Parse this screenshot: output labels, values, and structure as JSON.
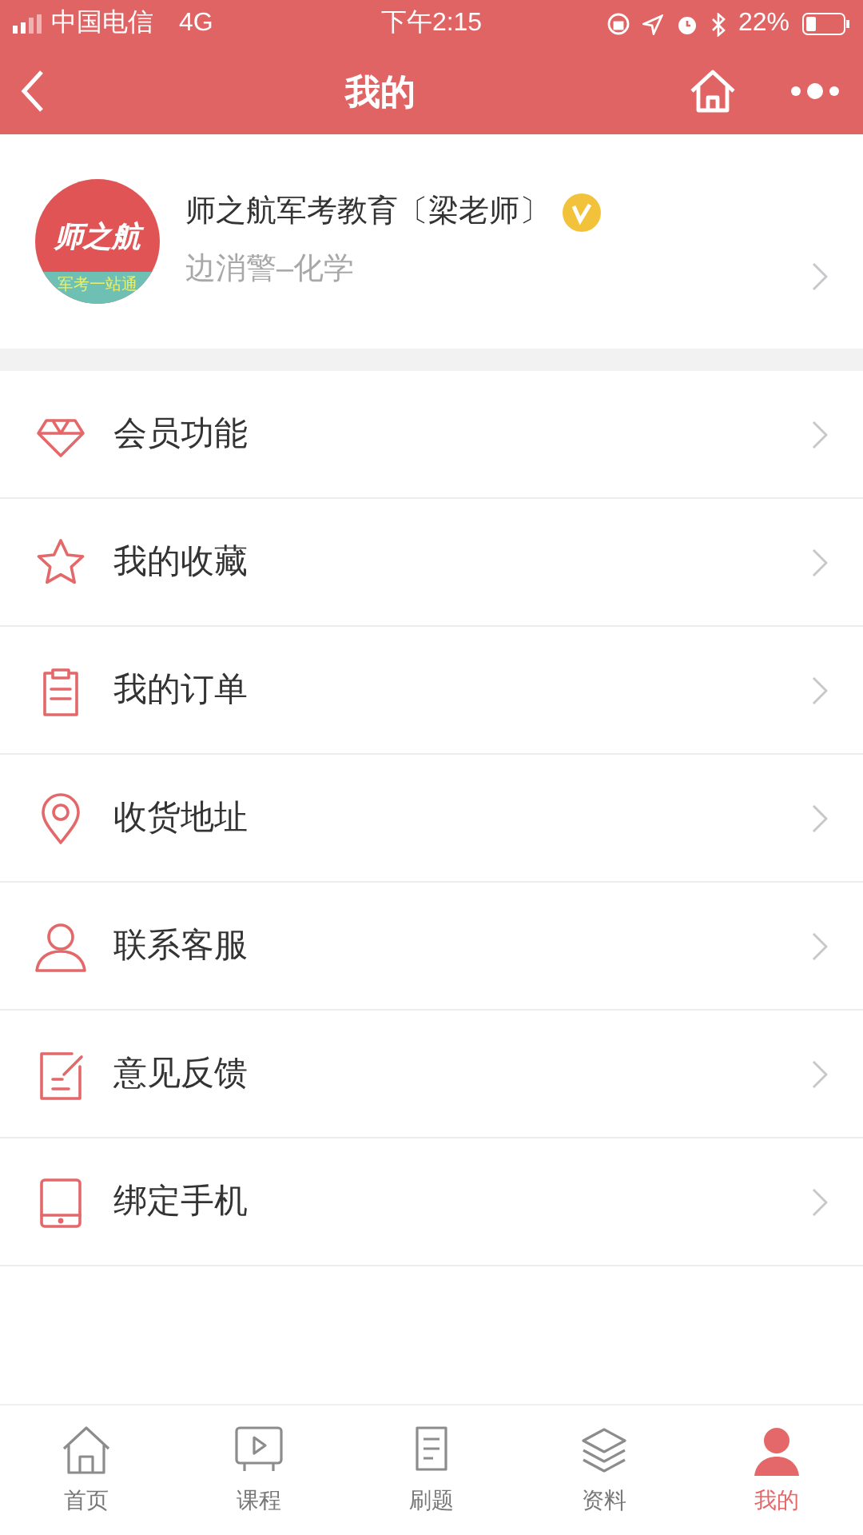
{
  "status_bar": {
    "carrier": "中国电信",
    "network": "4G",
    "time": "下午2:15",
    "battery": "22%"
  },
  "nav": {
    "title": "我的"
  },
  "profile": {
    "logo_text": "师之航",
    "logo_slogan": "军考一站通",
    "name": "师之航军考教育〔梁老师〕",
    "verified": true,
    "subtitle": "边消警–化学"
  },
  "menu": [
    {
      "kind": "diamond",
      "label": "会员功能"
    },
    {
      "kind": "star",
      "label": "我的收藏"
    },
    {
      "kind": "clipboard",
      "label": "我的订单"
    },
    {
      "kind": "pin",
      "label": "收货地址"
    },
    {
      "kind": "person",
      "label": "联系客服"
    },
    {
      "kind": "edit",
      "label": "意见反馈"
    },
    {
      "kind": "tablet",
      "label": "绑定手机"
    }
  ],
  "tabs": [
    {
      "kind": "home",
      "label": "首页",
      "selected": false
    },
    {
      "kind": "video",
      "label": "课程",
      "selected": false
    },
    {
      "kind": "doc",
      "label": "刷题",
      "selected": false
    },
    {
      "kind": "layers",
      "label": "资料",
      "selected": false
    },
    {
      "kind": "person",
      "label": "我的",
      "selected": true
    }
  ]
}
